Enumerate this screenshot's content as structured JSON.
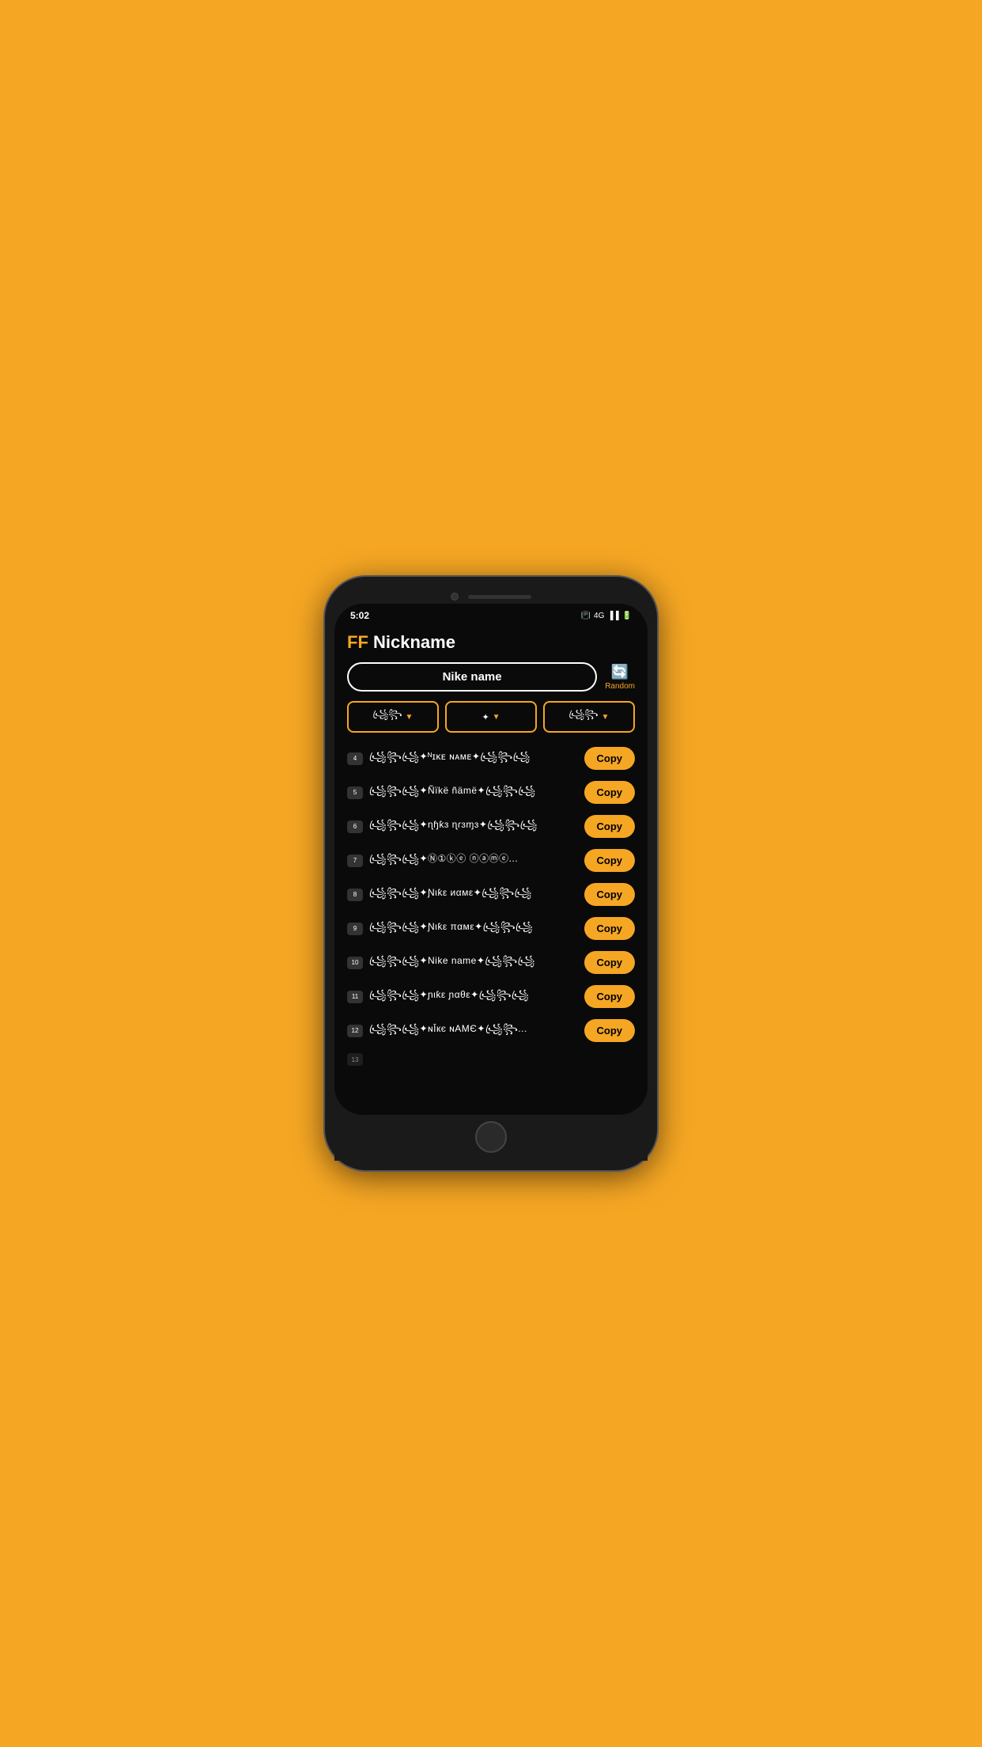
{
  "statusBar": {
    "time": "5:02",
    "icons": [
      "📳",
      "4G",
      "📶",
      "🔋"
    ]
  },
  "header": {
    "ff": "FF",
    "title": "Nickname"
  },
  "searchBox": {
    "value": "Nike name"
  },
  "randomButton": {
    "label": "Random",
    "icon": "🔄"
  },
  "filters": [
    {
      "label": "꧁ꦿ꧂",
      "symbol": "▼"
    },
    {
      "label": "✦",
      "symbol": "▼"
    },
    {
      "label": "꧁ꦿ꧂",
      "symbol": "▼"
    }
  ],
  "nicknames": [
    {
      "num": "4",
      "text": "꧁ꦿ꧂꧁ꦿ✦ᴺɪᴋᴇ ɴᴀᴍᴇ✦꧁ꦿ꧂꧁ꦿ"
    },
    {
      "num": "5",
      "text": "꧁ꦿ꧂꧁ꦿ✦Ñïkë ñämë✦꧁ꦿ꧂꧁ꦿ"
    },
    {
      "num": "6",
      "text": "꧁ꦿ꧂꧁ꦿ✦ɳɧƙɜ ɳɾɜɱɜ✦꧁ꦿ꧂꧁ꦿ"
    },
    {
      "num": "7",
      "text": "꧁ꦿ꧂꧁ꦿ✦Ⓝ①ⓚⓔ ⓝⓐⓜⓔ..."
    },
    {
      "num": "8",
      "text": "꧁ꦿ꧂꧁ꦿ✦Ɲιƙε иαмε✦꧁ꦿ꧂꧁ꦿ"
    },
    {
      "num": "9",
      "text": "꧁ꦿ꧂꧁ꦿ✦Ɲιƙε παмε✦꧁ꦿ꧂꧁ꦿ"
    },
    {
      "num": "10",
      "text": "꧁ꦿ꧂꧁ꦿ✦Nike name✦꧁ꦿ꧂꧁ꦿ"
    },
    {
      "num": "11",
      "text": "꧁ꦿ꧂꧁ꦿ✦ɲιƙε ɲαθε✦꧁ꦿ꧂꧁ꦿ"
    },
    {
      "num": "12",
      "text": "꧁ꦿ꧂꧁ꦿ✦ɴĪкє ɴAMЄ✦꧁ꦿ꧂..."
    }
  ],
  "copyLabel": "Copy",
  "partialNum": "13"
}
